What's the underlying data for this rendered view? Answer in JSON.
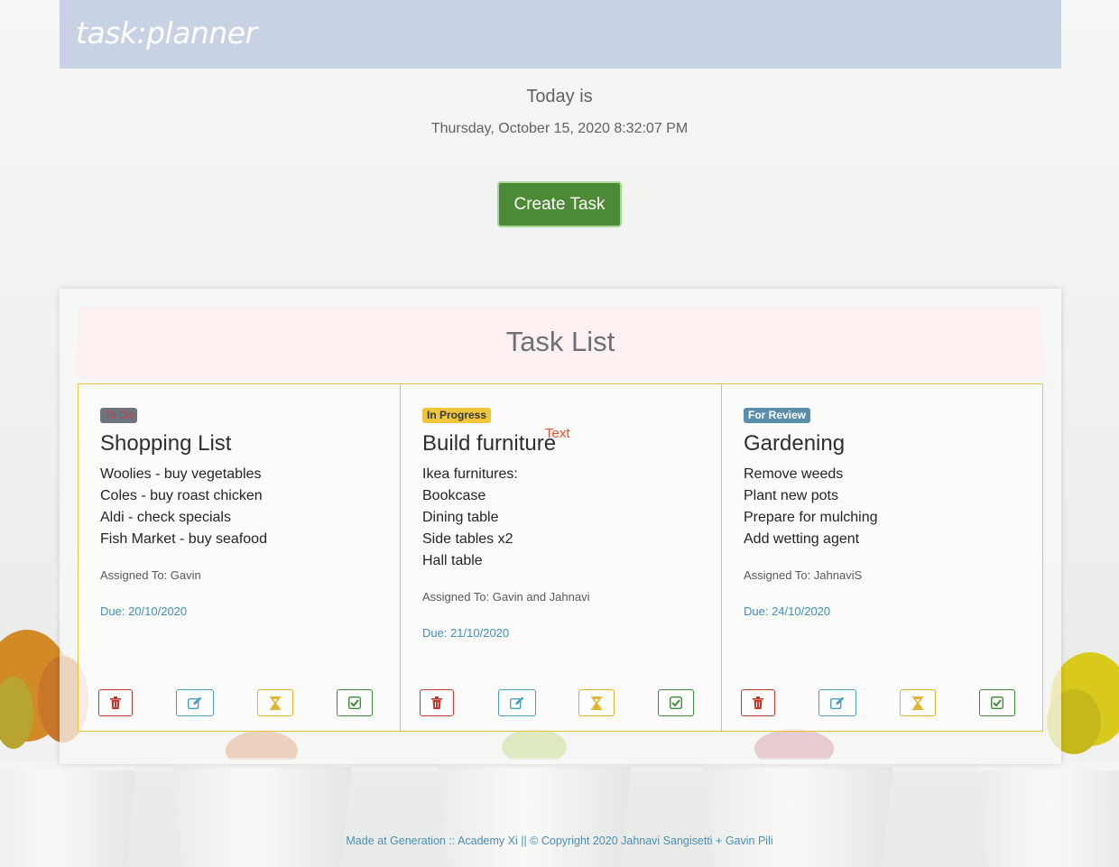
{
  "header": {
    "brand": "task:planner"
  },
  "date": {
    "label": "Today is",
    "value": "Thursday, October 15, 2020 8:32:07 PM"
  },
  "create_button": {
    "label": "Create Task"
  },
  "task_list": {
    "title": "Task List",
    "cards": [
      {
        "status": "To Do",
        "title": "Shopping List",
        "lines": [
          "Woolies - buy vegetables",
          "Coles - buy roast chicken",
          "Aldi - check specials",
          "Fish Market - buy seafood"
        ],
        "assigned": "Assigned To: Gavin",
        "due": "Due: 20/10/2020"
      },
      {
        "status": "In Progress",
        "title": "Build furniture",
        "marker": "Text",
        "lines": [
          "Ikea furnitures:",
          "Bookcase",
          "Dining table",
          "Side tables x2",
          "Hall table"
        ],
        "assigned": "Assigned To: Gavin and Jahnavi",
        "due": "Due: 21/10/2020"
      },
      {
        "status": "For Review",
        "title": "Gardening",
        "lines": [
          "Remove weeds",
          "Plant new pots",
          "Prepare for mulching",
          "Add wetting agent"
        ],
        "assigned": "Assigned To: JahnaviS",
        "due": "Due: 24/10/2020"
      }
    ]
  },
  "action_icons": [
    "trash-icon",
    "edit-icon",
    "hourglass-icon",
    "check-square-icon"
  ],
  "footer": {
    "text": "Made at Generation :: Academy Xi || © Copyright 2020 Jahnavi Sangisetti + Gavin Pili"
  },
  "colors": {
    "header_bg": "#c7d2e5",
    "create_button": "#4c8a36",
    "card_border": "#e8c33d",
    "badge_todo": "#6c757d",
    "badge_progress": "#f0c43b",
    "badge_review": "#5b8fa9",
    "due_text": "#3f8fb5"
  }
}
